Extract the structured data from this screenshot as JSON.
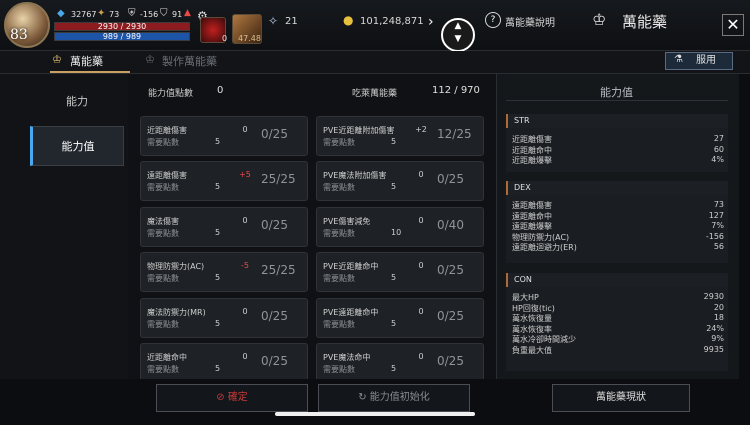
{
  "player": {
    "level": "83",
    "stat1": "32767",
    "stat2": "73",
    "stat3": "-156",
    "stat4": "91",
    "hp_text": "2930 / 2930",
    "mp_text": "989 / 989",
    "hp_fraction": 1.0,
    "mp_fraction": 1.0,
    "slot1_count": "0",
    "slot2_text": "47.48"
  },
  "resources": {
    "gem_count": "21",
    "gold": "101,248,871"
  },
  "header": {
    "help_label": "萬能藥說明",
    "title": "萬能藥",
    "close_label": "✕"
  },
  "tabs": {
    "tab1": "萬能藥",
    "tab2": "製作萬能藥",
    "use_button": "服用"
  },
  "nav": {
    "item1": "能力",
    "item2": "能力值"
  },
  "summary": {
    "points_label": "能力值點數",
    "points_value": "0",
    "elixir_label": "吃萊萬能藥",
    "elixir_value": "112 / 970"
  },
  "cards_left": [
    {
      "name": "近距離傷害",
      "need_label": "需要點數",
      "need": "5",
      "bonus": "0",
      "frac": "0/25",
      "bonus_type": "zero"
    },
    {
      "name": "遠距離傷害",
      "need_label": "需要點數",
      "need": "5",
      "bonus": "+5",
      "frac": "25/25",
      "bonus_type": "neg"
    },
    {
      "name": "魔法傷害",
      "need_label": "需要點數",
      "need": "5",
      "bonus": "0",
      "frac": "0/25",
      "bonus_type": "zero"
    },
    {
      "name": "物理防禦力(AC)",
      "need_label": "需要點數",
      "need": "5",
      "bonus": "-5",
      "frac": "25/25",
      "bonus_type": "neg"
    },
    {
      "name": "魔法防禦力(MR)",
      "need_label": "需要點數",
      "need": "5",
      "bonus": "0",
      "frac": "0/25",
      "bonus_type": "zero"
    },
    {
      "name": "近距離命中",
      "need_label": "需要點數",
      "need": "5",
      "bonus": "0",
      "frac": "0/25",
      "bonus_type": "zero"
    }
  ],
  "cards_right": [
    {
      "name": "PVE近距離附加傷害",
      "need_label": "需要點數",
      "need": "5",
      "bonus": "+2",
      "frac": "12/25",
      "bonus_type": "zero"
    },
    {
      "name": "PVE魔法附加傷害",
      "need_label": "需要點數",
      "need": "5",
      "bonus": "0",
      "frac": "0/25",
      "bonus_type": "zero"
    },
    {
      "name": "PVE傷害減免",
      "need_label": "需要點數",
      "need": "10",
      "bonus": "0",
      "frac": "0/40",
      "bonus_type": "zero"
    },
    {
      "name": "PVE近距離命中",
      "need_label": "需要點數",
      "need": "5",
      "bonus": "0",
      "frac": "0/25",
      "bonus_type": "zero"
    },
    {
      "name": "PVE遠距離命中",
      "need_label": "需要點數",
      "need": "5",
      "bonus": "0",
      "frac": "0/25",
      "bonus_type": "zero"
    },
    {
      "name": "PVE魔法命中",
      "need_label": "需要點數",
      "need": "5",
      "bonus": "0",
      "frac": "0/25",
      "bonus_type": "zero"
    }
  ],
  "stats_panel": {
    "title": "能力值",
    "str_label": "STR",
    "str": [
      {
        "l": "近距離傷害",
        "r": "27"
      },
      {
        "l": "近距離命中",
        "r": "60"
      },
      {
        "l": "近距離爆擊",
        "r": "4%"
      }
    ],
    "dex_label": "DEX",
    "dex": [
      {
        "l": "遠距離傷害",
        "r": "73"
      },
      {
        "l": "遠距離命中",
        "r": "127"
      },
      {
        "l": "遠距離爆擊",
        "r": "7%"
      },
      {
        "l": "物理防禦力(AC)",
        "r": "-156"
      },
      {
        "l": "遠距離迴避力(ER)",
        "r": "56"
      }
    ],
    "con_label": "CON",
    "con": [
      {
        "l": "最大HP",
        "r": "2930"
      },
      {
        "l": "HP回復(tic)",
        "r": "20"
      },
      {
        "l": "萬水恢復量",
        "r": "18"
      },
      {
        "l": "萬水恢復率",
        "r": "24%"
      },
      {
        "l": "萬水冷卻時間減少",
        "r": "9%"
      },
      {
        "l": "負重最大值",
        "r": "9935"
      }
    ]
  },
  "bottom": {
    "confirm": "確定",
    "reset": "能力值初始化",
    "status": "萬能藥現狀"
  }
}
